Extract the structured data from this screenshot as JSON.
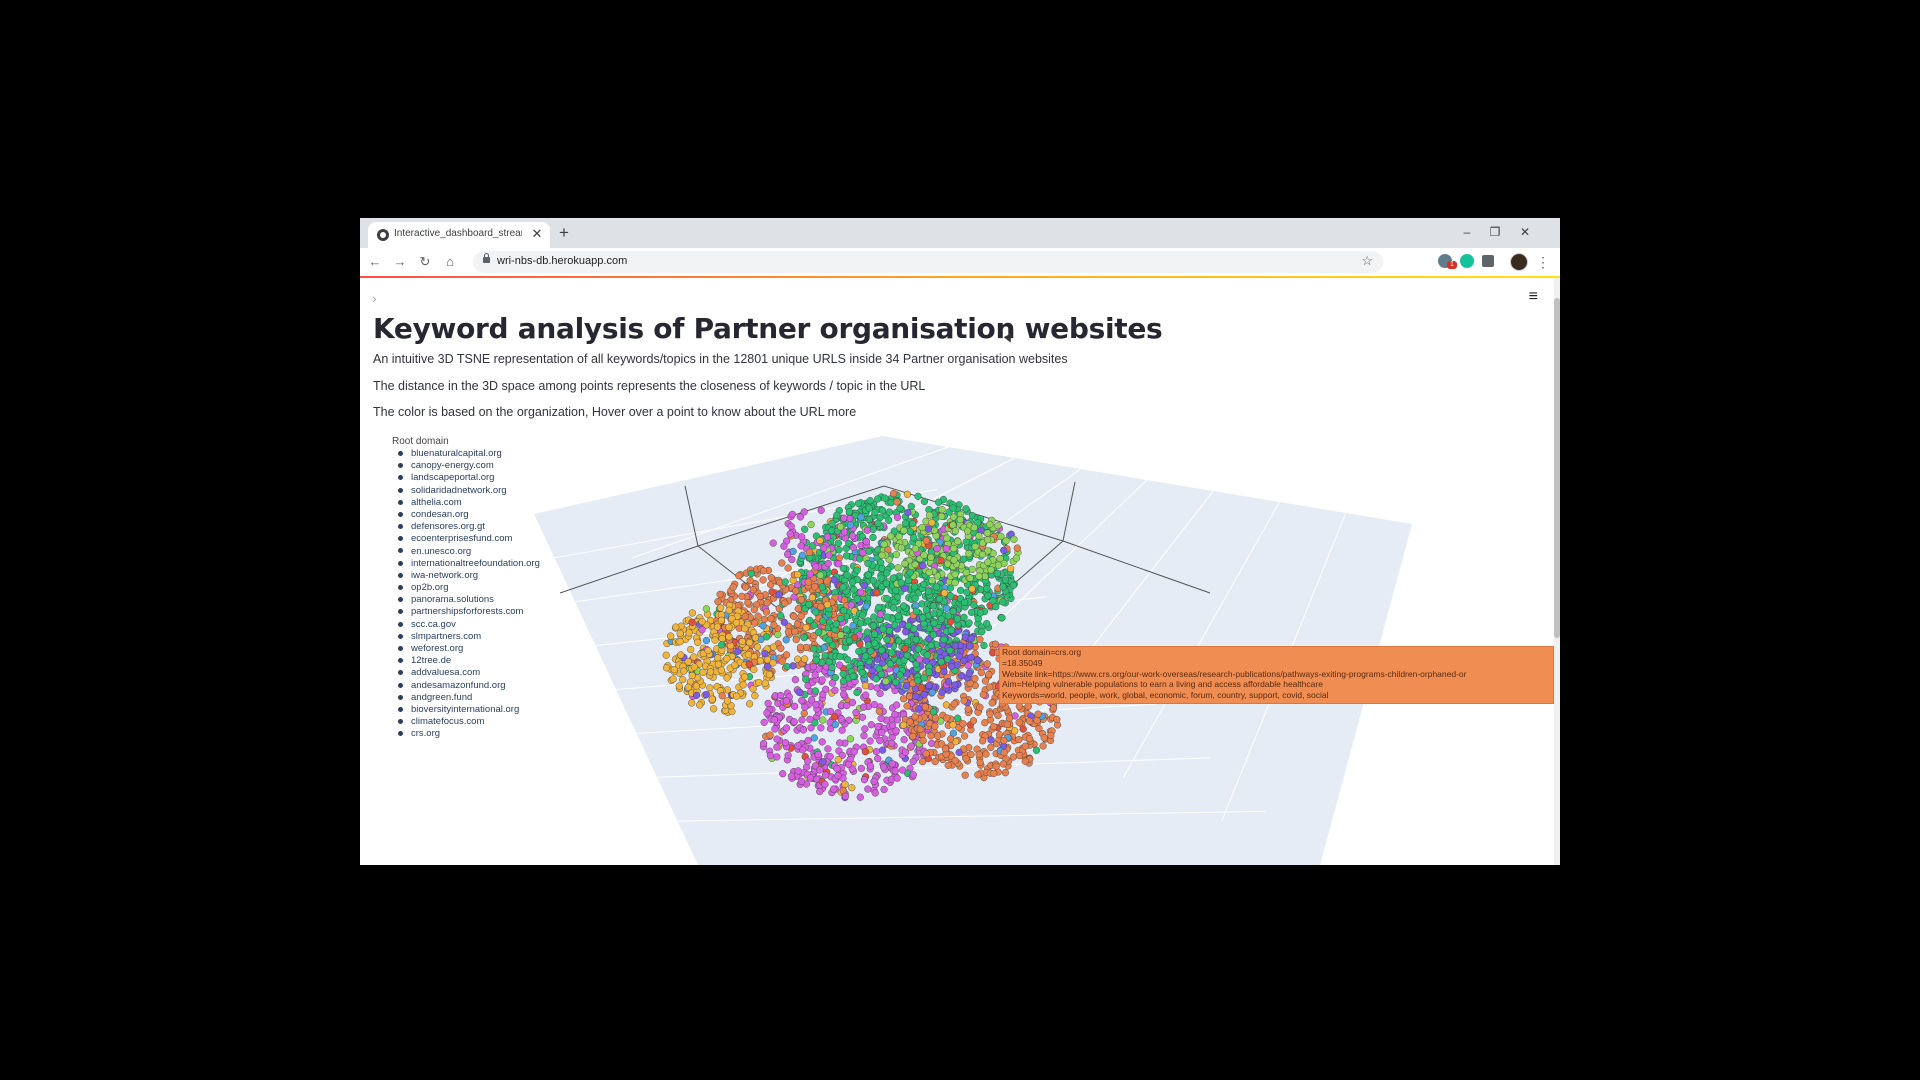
{
  "browser": {
    "tab_title": "Interactive_dashboard_streamlit",
    "tab_close": "✕",
    "new_tab": "+",
    "url": "wri-nbs-db.herokuapp.com",
    "extension_badge": "1",
    "window_controls": [
      "–",
      "❐",
      "✕"
    ],
    "nav": {
      "back": "←",
      "forward": "→",
      "reload": "↻",
      "home": "⌂",
      "star": "☆",
      "menu": "⋮"
    },
    "extension_icons": [
      "extension-badge-icon",
      "grammarly-icon",
      "puzzle-extensions-icon"
    ]
  },
  "app": {
    "sidebar_toggle": "›",
    "menu": "≡",
    "title": "Keyword analysis of Partner organisation websites",
    "paragraphs": [
      "An intuitive 3D TSNE representation of all keywords/topics in the 12801 unique URLS inside 34 Partner organisation websites",
      "The distance in the 3D space among points represents the closeness of keywords / topic in the URL",
      "The color is based on the organization, Hover over a point to know about the URL more"
    ],
    "accent_color": "#ff4b4b"
  },
  "plot": {
    "legend_title": "Root domain",
    "legend_items": [
      "bluenaturalcapital.org",
      "canopy-energy.com",
      "landscapeportal.org",
      "solidaridadnetwork.org",
      "althelia.com",
      "condesan.org",
      "defensores.org.gt",
      "ecoenterprisesfund.com",
      "en.unesco.org",
      "internationaltreefoundation.org",
      "iwa-network.org",
      "op2b.org",
      "panorama.solutions",
      "partnershipsforforests.com",
      "scc.ca.gov",
      "slmpartners.com",
      "weforest.org",
      "12tree.de",
      "addvaluesa.com",
      "andesamazonfund.org",
      "andgreen.fund",
      "bioversityinternational.org",
      "climatefocus.com",
      "crs.org"
    ],
    "cluster_colors": [
      "#2bbf73",
      "#e8804d",
      "#d65ee0",
      "#f0b43c",
      "#7b5be8",
      "#8fd45a",
      "#e0503c",
      "#4fa3e0"
    ],
    "hover": [
      "Root domain=crs.org",
      "=18.35049",
      "Website link=https://www.crs.org/our-work-overseas/research-publications/pathways-exiting-programs-children-orphaned-or",
      "Aim=Helping vulnerable populations to earn a living and access affordable healthcare",
      "Keywords=world, people, work, global, economic, forum, country, support, covid, social"
    ]
  }
}
